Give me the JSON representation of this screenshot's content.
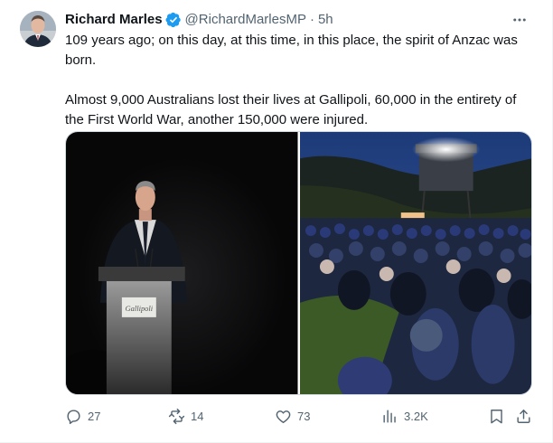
{
  "author": {
    "name": "Richard Marles",
    "handle": "@RichardMarlesMP",
    "separator": "·",
    "time": "5h",
    "verified": true
  },
  "tweet": {
    "paragraph1": "109 years ago; on this day, at this time, in this place, the spirit of Anzac was born.",
    "paragraph2": "Almost 9,000 Australians lost their lives at Gallipoli, 60,000 in the entirety of the First World War, another 150,000 were injured."
  },
  "media": {
    "photo1": {
      "lectern_text": "Gallipoli"
    }
  },
  "actions": {
    "replies": "27",
    "retweets": "14",
    "likes": "73",
    "views": "3.2K"
  },
  "colors": {
    "text": "#0f1419",
    "secondary": "#536471",
    "verified": "#1d9bf0"
  }
}
